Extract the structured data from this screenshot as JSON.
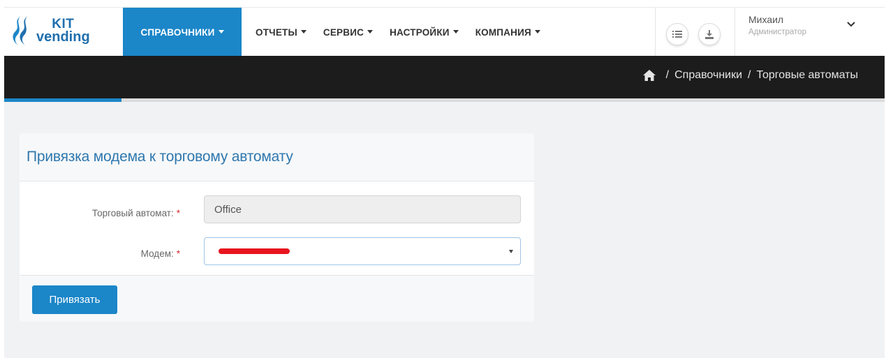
{
  "brand": {
    "line1": "KIT",
    "line2": "vending",
    "color": "#1f6fae"
  },
  "nav": {
    "items": [
      {
        "label": "СПРАВОЧНИКИ",
        "active": true
      },
      {
        "label": "ОТЧЕТЫ",
        "active": false
      },
      {
        "label": "СЕРВИС",
        "active": false
      },
      {
        "label": "НАСТРОЙКИ",
        "active": false
      },
      {
        "label": "КОМПАНИЯ",
        "active": false
      }
    ],
    "accent": "#1b86c8"
  },
  "toolbar": {
    "icons": [
      "list-icon",
      "download-icon"
    ]
  },
  "user": {
    "name": "Михаил",
    "role": "Администратор"
  },
  "breadcrumb": {
    "home_icon": "home-icon",
    "separator": "/",
    "items": [
      "Справочники",
      "Торговые автоматы"
    ]
  },
  "form": {
    "title": "Привязка модема к торговому автомату",
    "fields": [
      {
        "label": "Торговый автомат:",
        "required_mark": "*",
        "value": "Office",
        "readonly": true
      },
      {
        "label": "Модем:",
        "required_mark": "*",
        "value": "",
        "redacted": true,
        "type": "select"
      }
    ],
    "submit_label": "Привязать"
  }
}
